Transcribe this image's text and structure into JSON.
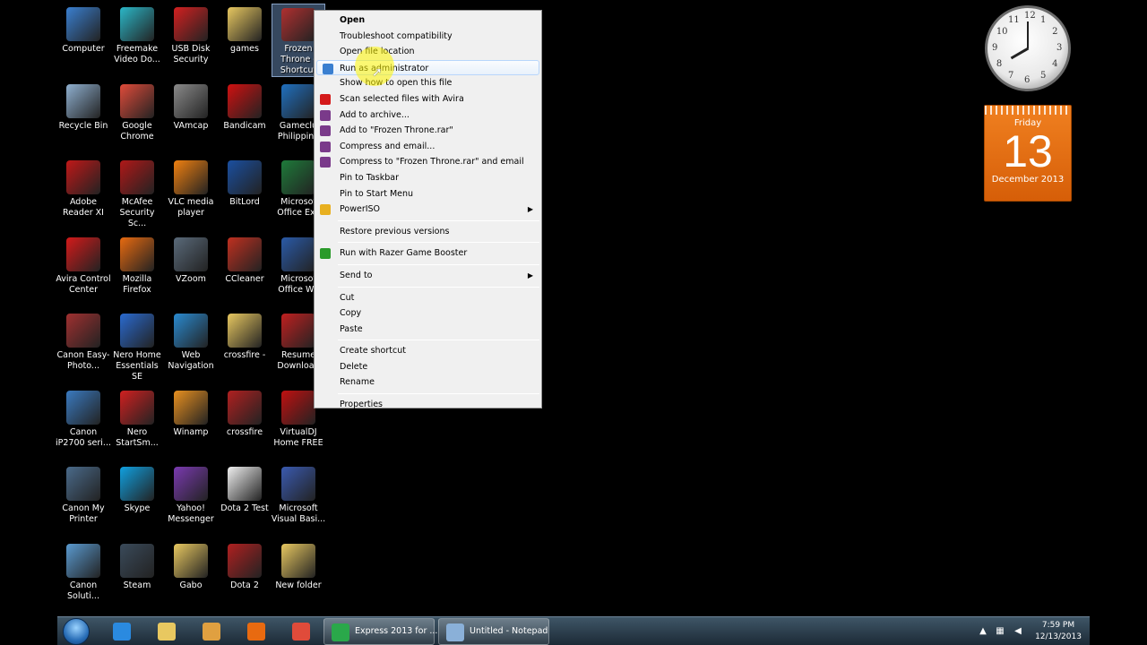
{
  "desktop": {
    "icons": [
      {
        "label": "Computer",
        "color": "#3a7fd0"
      },
      {
        "label": "Freemake Video Do...",
        "color": "#2bb7c8"
      },
      {
        "label": "USB Disk Security",
        "color": "#d32020"
      },
      {
        "label": "games",
        "color": "#e8c860"
      },
      {
        "label": "Frozen Throne - Shortcut",
        "color": "#b03030"
      },
      {
        "label": "Recycle Bin",
        "color": "#8fb0d0"
      },
      {
        "label": "Google Chrome",
        "color": "#e04b3a"
      },
      {
        "label": "VAmcap",
        "color": "#8a8a8a"
      },
      {
        "label": "Bandicam",
        "color": "#d01010"
      },
      {
        "label": "Gameclu Philippine",
        "color": "#2070c0"
      },
      {
        "label": "Adobe Reader XI",
        "color": "#c01818"
      },
      {
        "label": "McAfee Security Sc...",
        "color": "#b01818"
      },
      {
        "label": "VLC media player",
        "color": "#f08010"
      },
      {
        "label": "BitLord",
        "color": "#1a4fa0"
      },
      {
        "label": "Microsof Office Exc",
        "color": "#1e7a3a"
      },
      {
        "label": "Avira Control Center",
        "color": "#d41a1a"
      },
      {
        "label": "Mozilla Firefox",
        "color": "#e86a10"
      },
      {
        "label": "VZoom",
        "color": "#5a6a7a"
      },
      {
        "label": "CCleaner",
        "color": "#c03020"
      },
      {
        "label": "Microsof Office Wo",
        "color": "#2a5aa8"
      },
      {
        "label": "Canon Easy-Photo...",
        "color": "#a03030"
      },
      {
        "label": "Nero Home Essentials SE",
        "color": "#2a6ad0"
      },
      {
        "label": "Web Navigation",
        "color": "#2a8ad0"
      },
      {
        "label": "crossfire -",
        "color": "#e8c860"
      },
      {
        "label": "Resume Download",
        "color": "#c02020"
      },
      {
        "label": "Canon iP2700 seri...",
        "color": "#3a7ac0"
      },
      {
        "label": "Nero StartSm...",
        "color": "#d02020"
      },
      {
        "label": "Winamp",
        "color": "#e89020"
      },
      {
        "label": "crossfire",
        "color": "#b02020"
      },
      {
        "label": "VirtualDJ Home FREE",
        "color": "#c01010"
      },
      {
        "label": "Canon My Printer",
        "color": "#4a6a8a"
      },
      {
        "label": "Skype",
        "color": "#10a0e0"
      },
      {
        "label": "Yahoo! Messenger",
        "color": "#7a3ab0"
      },
      {
        "label": "Dota 2 Test",
        "color": "#f0f0f0"
      },
      {
        "label": "Microsoft Visual Basi...",
        "color": "#3a5ab0"
      },
      {
        "label": "Canon Soluti...",
        "color": "#5a9ad0"
      },
      {
        "label": "Steam",
        "color": "#3a4a5a"
      },
      {
        "label": "Gabo",
        "color": "#e8c860"
      },
      {
        "label": "Dota 2",
        "color": "#b02020"
      },
      {
        "label": "New folder",
        "color": "#e8c860"
      }
    ]
  },
  "context_menu": {
    "items": [
      {
        "label": "Open",
        "bold": true
      },
      {
        "label": "Troubleshoot compatibility"
      },
      {
        "label": "Open file location"
      },
      {
        "label": "Run as administrator",
        "icon": "#3a7fd0",
        "hover": true
      },
      {
        "label": "Show how to open this file"
      },
      {
        "label": "Scan selected files with Avira",
        "icon": "#d41a1a"
      },
      {
        "label": "Add to archive...",
        "icon": "#7a3a8a"
      },
      {
        "label": "Add to \"Frozen Throne.rar\"",
        "icon": "#7a3a8a"
      },
      {
        "label": "Compress and email...",
        "icon": "#7a3a8a"
      },
      {
        "label": "Compress to \"Frozen Throne.rar\" and email",
        "icon": "#7a3a8a"
      },
      {
        "label": "Pin to Taskbar"
      },
      {
        "label": "Pin to Start Menu"
      },
      {
        "label": "PowerISO",
        "icon": "#e8b020",
        "submenu": true
      },
      {
        "sep": true
      },
      {
        "label": "Restore previous versions"
      },
      {
        "sep": true
      },
      {
        "label": "Run with Razer Game Booster",
        "icon": "#2a9a2a"
      },
      {
        "sep": true
      },
      {
        "label": "Send to",
        "submenu": true
      },
      {
        "sep": true
      },
      {
        "label": "Cut"
      },
      {
        "label": "Copy"
      },
      {
        "label": "Paste"
      },
      {
        "sep": true
      },
      {
        "label": "Create shortcut"
      },
      {
        "label": "Delete"
      },
      {
        "label": "Rename"
      },
      {
        "sep": true
      },
      {
        "label": "Properties"
      }
    ]
  },
  "calendar": {
    "day": "Friday",
    "date": "13",
    "month": "December 2013"
  },
  "clock": {
    "numbers": [
      "12",
      "1",
      "2",
      "3",
      "4",
      "5",
      "6",
      "7",
      "8",
      "9",
      "10",
      "11"
    ]
  },
  "taskbar": {
    "pinned": [
      {
        "name": "ie",
        "color": "#2a8ae0"
      },
      {
        "name": "explorer",
        "color": "#e8c860"
      },
      {
        "name": "media",
        "color": "#e0a040"
      },
      {
        "name": "firefox",
        "color": "#e86a10"
      },
      {
        "name": "chrome",
        "color": "#e04b3a"
      }
    ],
    "windows": [
      {
        "label": "Express 2013 for ...",
        "color": "#2aa84a"
      },
      {
        "label": "Untitled - Notepad",
        "color": "#8ab0d8"
      }
    ],
    "time": "7:59 PM",
    "date": "12/13/2013"
  }
}
